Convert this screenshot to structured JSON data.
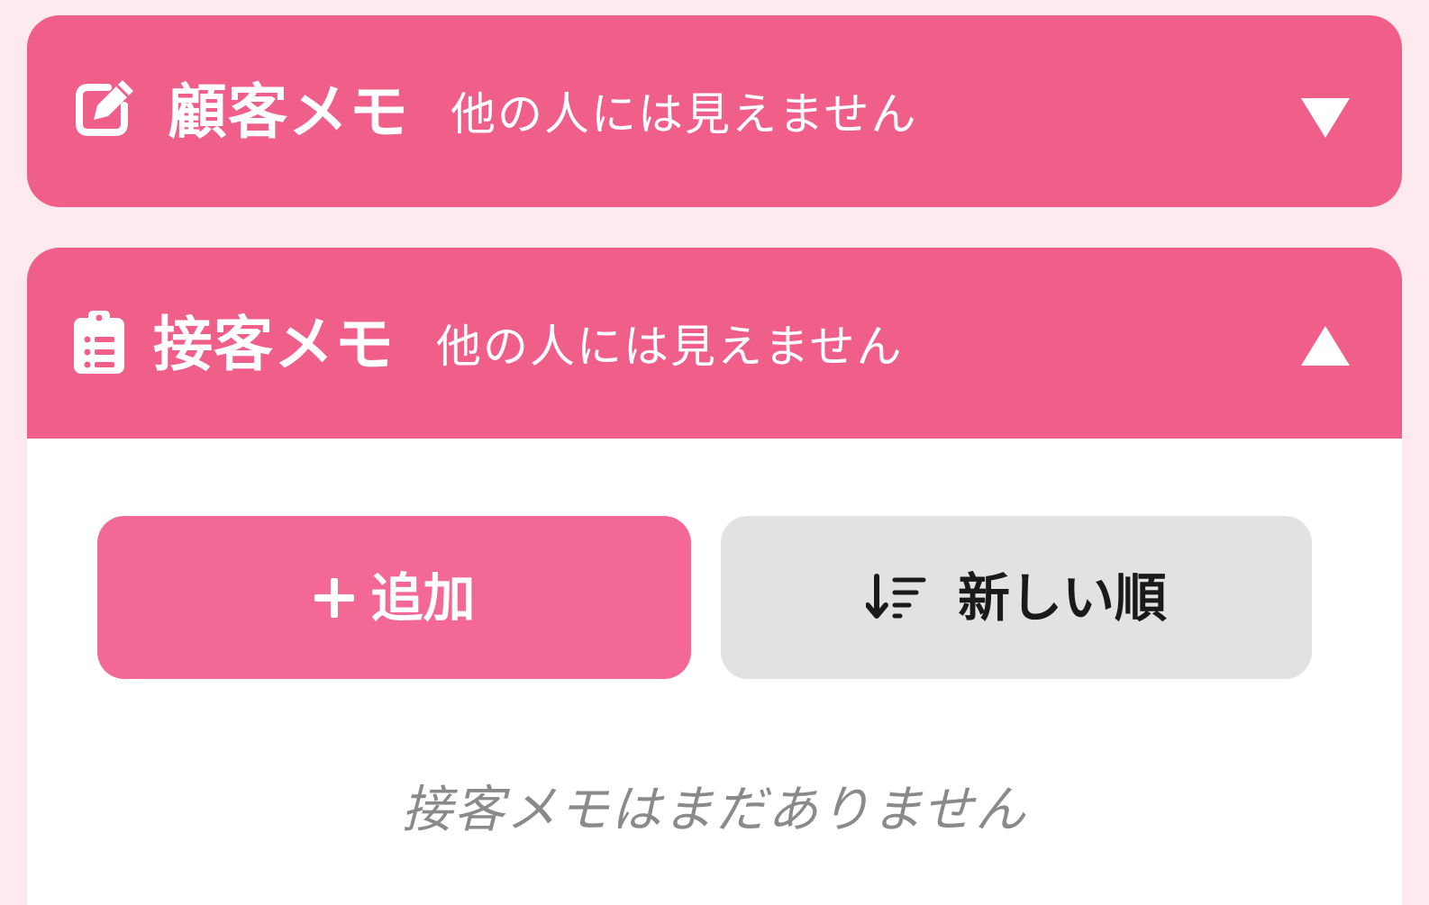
{
  "colors": {
    "page_background": "#fde9ee",
    "header_pink": "#ef5f8a",
    "add_button_pink": "#f36894",
    "sort_button_gray": "#e2e2e2",
    "empty_text_gray": "#8a8a8a"
  },
  "customer_memo": {
    "title": "顧客メモ",
    "subtitle": "他の人には見えません",
    "icon": "edit-note-icon",
    "toggle_icon": "chevron-down-icon",
    "expanded": false
  },
  "service_memo": {
    "title": "接客メモ",
    "subtitle": "他の人には見えません",
    "icon": "clipboard-icon",
    "toggle_icon": "chevron-up-icon",
    "expanded": true,
    "add_button": {
      "icon": "plus-icon",
      "label": "追加"
    },
    "sort_button": {
      "icon": "sort-descending-icon",
      "label": "新しい順"
    },
    "empty_message": "接客メモはまだありません"
  }
}
